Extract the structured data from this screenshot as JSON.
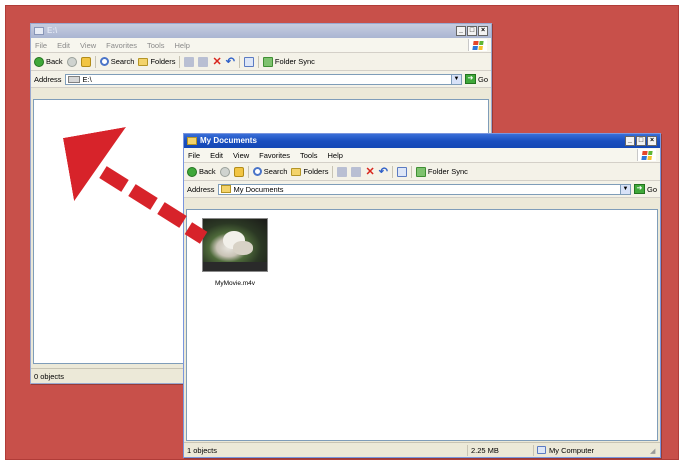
{
  "colors": {
    "background": "#c8504a",
    "arrow": "#d7232a",
    "title_active": "#1a4fbf"
  },
  "back_window": {
    "title": "E:\\",
    "menu": [
      "File",
      "Edit",
      "View",
      "Favorites",
      "Tools",
      "Help"
    ],
    "toolbar": {
      "back": "Back",
      "search": "Search",
      "folders": "Folders",
      "folder_sync": "Folder Sync"
    },
    "address_label": "Address",
    "address_value": "E:\\",
    "go_label": "Go",
    "status": "0 objects"
  },
  "front_window": {
    "title": "My Documents",
    "menu": [
      "File",
      "Edit",
      "View",
      "Favorites",
      "Tools",
      "Help"
    ],
    "toolbar": {
      "back": "Back",
      "search": "Search",
      "folders": "Folders",
      "folder_sync": "Folder Sync"
    },
    "address_label": "Address",
    "address_value": "My Documents",
    "go_label": "Go",
    "file": {
      "name": "MyMovie.m4v"
    },
    "status": {
      "objects": "1 objects",
      "size": "2.25 MB",
      "location": "My Computer"
    }
  },
  "icons": [
    "back-icon",
    "forward-icon",
    "up-folder-icon",
    "search-icon",
    "folders-icon",
    "move-to-icon",
    "copy-to-icon",
    "delete-icon",
    "undo-icon",
    "views-icon",
    "folder-sync-icon",
    "go-icon",
    "windows-logo-icon",
    "video-file-icon",
    "drag-arrow-icon"
  ],
  "window_controls": {
    "minimize": "_",
    "maximize": "□",
    "close": "×"
  }
}
